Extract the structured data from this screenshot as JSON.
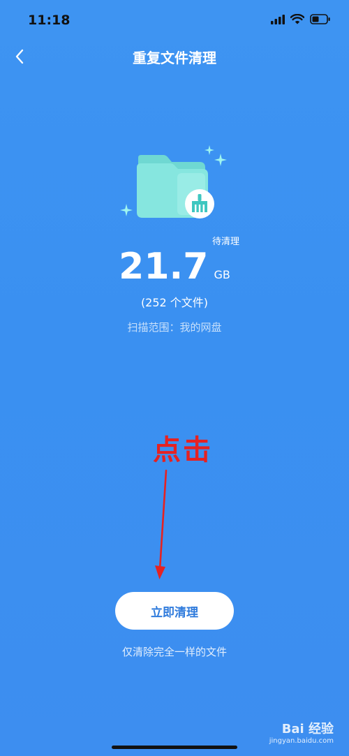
{
  "status_bar": {
    "time": "11:18"
  },
  "nav": {
    "title": "重复文件清理"
  },
  "summary": {
    "pending_label": "待清理",
    "size_value": "21.7",
    "size_unit": "GB",
    "file_count": "(252 个文件)",
    "scan_scope": "扫描范围：我的网盘"
  },
  "annotation": {
    "text": "点击"
  },
  "actions": {
    "clean_button_label": "立即清理",
    "clean_note": "仅清除完全一样的文件"
  },
  "watermark": {
    "brand": "Bai 经验",
    "url": "jingyan.baidu.com"
  },
  "colors": {
    "background": "#3e94f2",
    "folder": "#7ee3dc",
    "annotation": "#e52222",
    "button_text": "#2f7bdc"
  },
  "icons": [
    "signal-icon",
    "wifi-icon",
    "battery-icon",
    "back-chevron-icon",
    "folder-icon",
    "broom-icon",
    "sparkle-icon",
    "arrow-down-icon"
  ]
}
